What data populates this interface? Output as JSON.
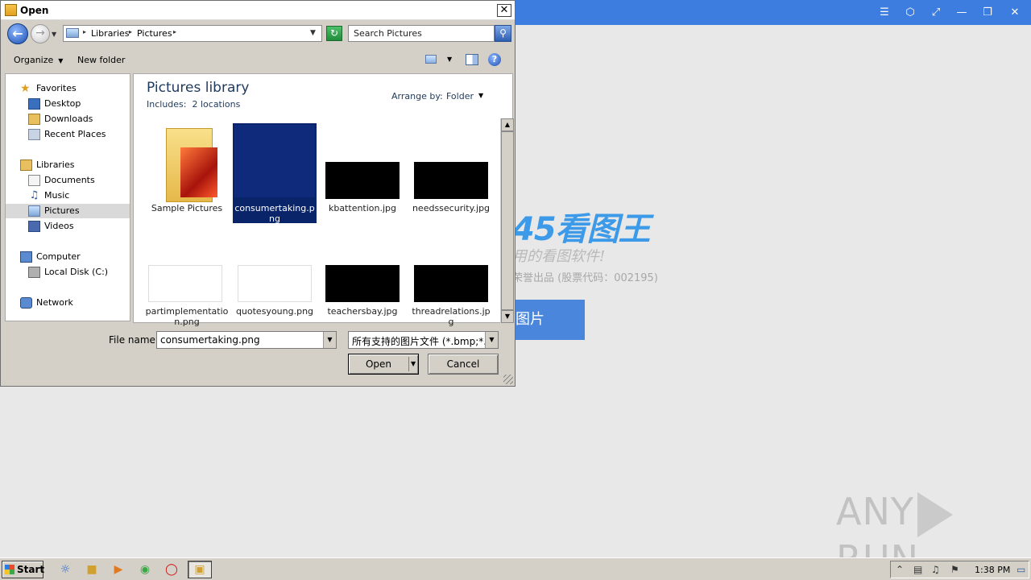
{
  "background_app": {
    "logo_text": "45看图王",
    "slogan": "用的看图软件!",
    "company": "荣誉出品 (股票代码：002195)",
    "open_button_label": "图片",
    "controls": [
      "☰",
      "⬡",
      "⤢",
      "—",
      "❐",
      "✕"
    ],
    "titlebar_color": "#3d7de0"
  },
  "watermark": {
    "left": "ANY",
    "right": "RUN"
  },
  "dialog": {
    "title": "Open",
    "close_label": "✕",
    "address": {
      "crumbs": [
        "Libraries",
        "Pictures"
      ]
    },
    "search_placeholder": "Search Pictures",
    "toolbar": {
      "organize": "Organize",
      "new_folder": "New folder",
      "help": "?"
    },
    "nav_pane": {
      "favorites": {
        "label": "Favorites",
        "items": [
          "Desktop",
          "Downloads",
          "Recent Places"
        ]
      },
      "libraries": {
        "label": "Libraries",
        "items": [
          "Documents",
          "Music",
          "Pictures",
          "Videos"
        ]
      },
      "computer": {
        "label": "Computer",
        "items": [
          "Local Disk (C:)"
        ]
      },
      "network": {
        "label": "Network"
      },
      "selected": "Pictures"
    },
    "library": {
      "title": "Pictures library",
      "includes_label": "Includes:",
      "includes_value": "2 locations",
      "arrange_label": "Arrange by:",
      "arrange_value": "Folder"
    },
    "files": [
      {
        "name": "Sample Pictures",
        "type": "folder"
      },
      {
        "name": "consumertaking.png",
        "type": "image",
        "selected": true
      },
      {
        "name": "kbattention.jpg",
        "type": "image"
      },
      {
        "name": "needssecurity.jpg",
        "type": "image"
      },
      {
        "name": "partimplementation.png",
        "type": "image"
      },
      {
        "name": "quotesyoung.png",
        "type": "image"
      },
      {
        "name": "teachersbay.jpg",
        "type": "image"
      },
      {
        "name": "threadrelations.jpg",
        "type": "image"
      }
    ],
    "file_name_label": "File name:",
    "file_name_value": "consumertaking.png",
    "filter_value": "所有支持的图片文件 (*.bmp;*.d",
    "open_label": "Open",
    "cancel_label": "Cancel",
    "selection_color": "#0a246a"
  },
  "taskbar": {
    "start_label": "Start",
    "clock": "1:38 PM"
  }
}
